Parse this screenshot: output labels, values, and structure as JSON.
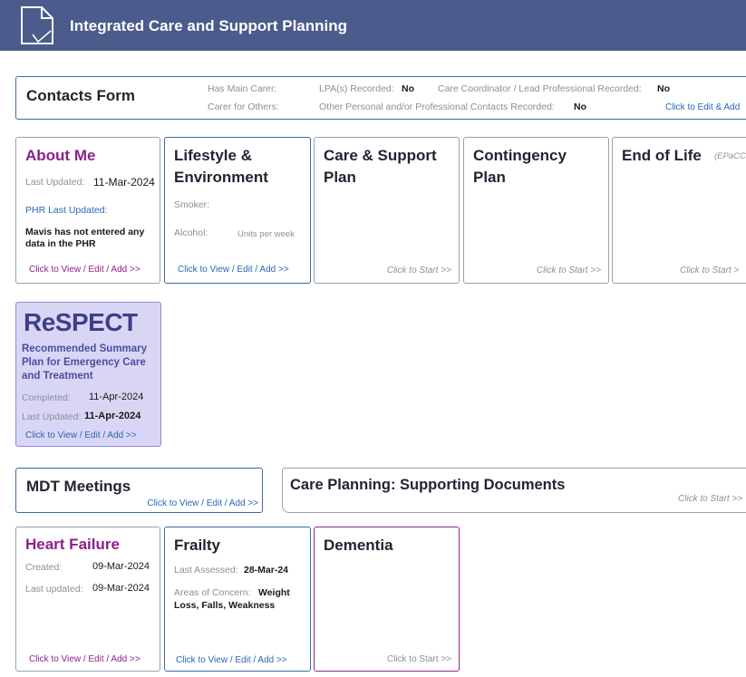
{
  "header": {
    "title": "Integrated Care and Support Planning",
    "icon": "document-icon"
  },
  "contacts": {
    "title": "Contacts Form",
    "has_main_carer_label": "Has Main Carer:",
    "carer_for_others_label": "Carer for Others:",
    "lpa_label": "LPA(s) Recorded:",
    "lpa_value": "No",
    "coordinator_label": "Care Coordinator / Lead Professional Recorded:",
    "coordinator_value": "No",
    "other_contacts_label": "Other Personal and/or Professional Contacts Recorded:",
    "other_contacts_value": "No",
    "link": "Click to Edit & Add"
  },
  "about_me": {
    "title": "About Me",
    "last_updated_label": "Last Updated:",
    "last_updated_value": "11-Mar-2024",
    "phr_label": "PHR Last Updated:",
    "phr_note": "Mavis has not entered any data in the PHR",
    "link": "Click to View / Edit / Add >>"
  },
  "lifestyle": {
    "title_line1": "Lifestyle &",
    "title_line2": "Environment",
    "smoker_label": "Smoker:",
    "alcohol_label": "Alcohol:",
    "alcohol_units": "Units per week",
    "link": "Click to View / Edit / Add >>"
  },
  "care_support": {
    "title_line1": "Care & Support",
    "title_line2": "Plan",
    "link": "Click to Start >>"
  },
  "contingency": {
    "title_line1": "Contingency",
    "title_line2": "Plan",
    "link": "Click to Start >>"
  },
  "end_of_life": {
    "title": "End of Life",
    "subtitle": "(EPaCCS)",
    "link": "Click to Start >"
  },
  "respect": {
    "logo": "ReSPECT",
    "description": "Recommended Summary Plan for Emergency Care and Treatment",
    "completed_label": "Completed:",
    "completed_value": "11-Apr-2024",
    "last_updated_label": "Last Updated:",
    "last_updated_value": "11-Apr-2024",
    "link": "Click to View / Edit / Add >>"
  },
  "mdt": {
    "title": "MDT Meetings",
    "link": "Click to View / Edit / Add >>"
  },
  "supporting_docs": {
    "title": "Care Planning: Supporting Documents",
    "link": "Click to Start >>"
  },
  "heart_failure": {
    "title": "Heart Failure",
    "created_label": "Created:",
    "created_value": "09-Mar-2024",
    "last_updated_label": "Last updated:",
    "last_updated_value": "09-Mar-2024",
    "link": "Click to View / Edit / Add >>"
  },
  "frailty": {
    "title": "Frailty",
    "last_assessed_label": "Last Assessed:",
    "last_assessed_value": "28-Mar-24",
    "areas_label": "Areas of Concern:",
    "areas_value_1": "Weight",
    "areas_value_2": "Loss, Falls, Weakness",
    "link": "Click to View / Edit / Add >>"
  },
  "dementia": {
    "title": "Dementia",
    "link": "Click to Start >>"
  },
  "colors": {
    "header": "#4a5b8c",
    "purple": "#8e1f8e",
    "link_blue": "#2b66b5",
    "respect_bg": "#d9d6f5"
  }
}
